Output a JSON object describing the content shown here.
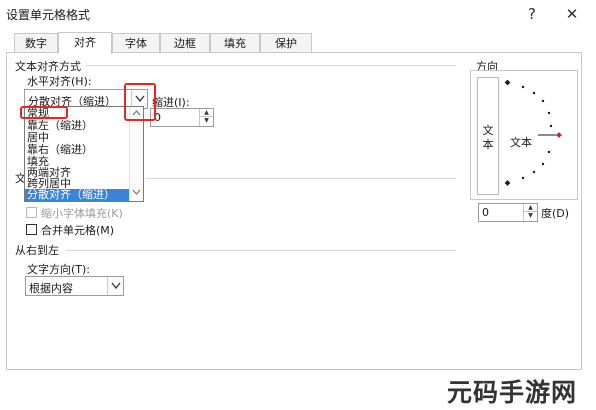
{
  "window": {
    "title": "设置单元格格式",
    "help_label": "?",
    "close_label": "✕"
  },
  "tabs": [
    {
      "label": "数字"
    },
    {
      "label": "对齐"
    },
    {
      "label": "字体"
    },
    {
      "label": "边框"
    },
    {
      "label": "填充"
    },
    {
      "label": "保护"
    }
  ],
  "active_tab": "对齐",
  "text_alignment": {
    "section_label": "文本对齐方式",
    "horizontal_label": "水平对齐(H):",
    "horizontal_value": "分散对齐（缩进）",
    "indent_label": "缩进(I):",
    "indent_value": "0",
    "dropdown_options": [
      "常规",
      "靠左（缩进）",
      "居中",
      "靠右（缩进）",
      "填充",
      "两端对齐",
      "跨列居中",
      "分散对齐（缩进）"
    ],
    "dropdown_selected": "分散对齐（缩进）"
  },
  "text_control": {
    "section_label_partial": "文",
    "shrink_label": "缩小字体填充(K)",
    "merge_label": "合并单元格(M)"
  },
  "rtl": {
    "section_label": "从右到左",
    "direction_label": "文字方向(T):",
    "direction_value": "根据内容"
  },
  "orientation": {
    "section_label": "方向",
    "vertical_text": "文本",
    "horizontal_text": "文本",
    "degrees_value": "0",
    "degrees_label": "度(D)"
  },
  "watermark": "元码手游网",
  "colors": {
    "highlight": "#e8242a",
    "selection": "#3a84d8",
    "dial_marker": "#c0262b"
  }
}
